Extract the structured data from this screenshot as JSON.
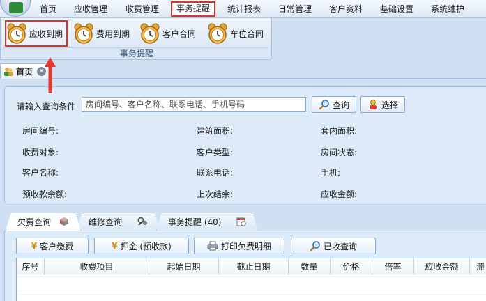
{
  "menu": {
    "items": [
      {
        "label": "首页"
      },
      {
        "label": "应收管理"
      },
      {
        "label": "收费管理"
      },
      {
        "label": "事务提醒"
      },
      {
        "label": "统计报表"
      },
      {
        "label": "日常管理"
      },
      {
        "label": "客户资料"
      },
      {
        "label": "基础设置"
      },
      {
        "label": "系统维护"
      }
    ],
    "active": "事务提醒"
  },
  "ribbon": {
    "buttons": [
      {
        "label": "应收到期",
        "icon": "alarm-clock-icon"
      },
      {
        "label": "费用到期",
        "icon": "alarm-clock-icon"
      },
      {
        "label": "客户合同",
        "icon": "alarm-clock-icon"
      },
      {
        "label": "车位合同",
        "icon": "alarm-clock-icon"
      }
    ],
    "group_label": "事务提醒"
  },
  "doc_tab": {
    "label": "首页",
    "icon": "home-user-icon",
    "close_icon": "close-icon"
  },
  "query": {
    "label": "请输入查询条件",
    "placeholder": "房间编号、客户名称、联系电话、手机号码",
    "search_button": "查询",
    "select_button": "选择"
  },
  "fields": {
    "room_no": "房间编号:",
    "building_area": "建筑面积:",
    "inner_area": "套内面积:",
    "charge_target": "收费对象:",
    "customer_type": "客户类型:",
    "room_status": "房间状态:",
    "customer_name": "客户名称:",
    "contact_phone": "联系电话:",
    "mobile": "手机:",
    "prepaid_balance": "预收款余额:",
    "last_settlement": "上次结余:",
    "receivable_amount": "应收金额:"
  },
  "sub_tabs": [
    {
      "label": "欠费查询",
      "icon": "box-icon"
    },
    {
      "label": "维修查询",
      "icon": "tools-icon"
    },
    {
      "label": "事务提醒 (40)",
      "icon": "calendar-icon"
    }
  ],
  "actions": {
    "pay": "客户缴费",
    "deposit": "押金 (预收款)",
    "print": "打印欠费明细",
    "received": "已收查询"
  },
  "grid": {
    "columns": [
      "序号",
      "收费项目",
      "起始日期",
      "截止日期",
      "数量",
      "价格",
      "倍率",
      "应收金额",
      "滞"
    ]
  },
  "colors": {
    "highlight_border": "#e0302a",
    "panel_bg": "#ddeaf8",
    "app_bg": "#cfe0f3"
  }
}
